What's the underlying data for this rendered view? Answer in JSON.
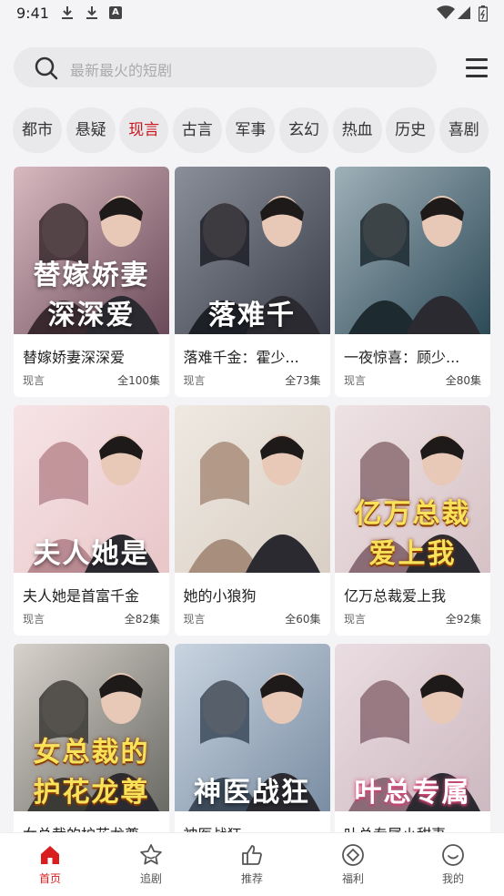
{
  "status": {
    "time": "9:41"
  },
  "search": {
    "placeholder": "最新最火的短剧"
  },
  "categories": [
    "都市",
    "悬疑",
    "现言",
    "古言",
    "军事",
    "玄幻",
    "热血",
    "历史",
    "喜剧"
  ],
  "active_category": "现言",
  "cards": [
    {
      "poster_text": "替嫁娇妻 深深爱",
      "title": "替嫁娇妻深深爱",
      "genre": "现言",
      "episodes": "全100集"
    },
    {
      "poster_text": "落难千",
      "title": "落难千金：霍少...",
      "genre": "现言",
      "episodes": "全73集"
    },
    {
      "poster_text": "",
      "title": "一夜惊喜：顾少...",
      "genre": "现言",
      "episodes": "全80集"
    },
    {
      "poster_text": "夫人她是",
      "title": "夫人她是首富千金",
      "genre": "现言",
      "episodes": "全82集"
    },
    {
      "poster_text": "",
      "title": "她的小狼狗",
      "genre": "现言",
      "episodes": "全60集"
    },
    {
      "poster_text": "亿万总裁 爱上我",
      "title": "亿万总裁爱上我",
      "genre": "现言",
      "episodes": "全92集"
    },
    {
      "poster_text": "女总裁的 护花龙尊",
      "title": "女总裁的护花龙尊",
      "genre": "",
      "episodes": ""
    },
    {
      "poster_text": "神医战狂",
      "title": "神医战狂",
      "genre": "",
      "episodes": ""
    },
    {
      "poster_text": "叶总专属",
      "title": "叶总专属小甜妻",
      "genre": "",
      "episodes": ""
    }
  ],
  "nav": [
    {
      "label": "首页",
      "icon": "home-icon",
      "active": true
    },
    {
      "label": "追剧",
      "icon": "star-icon",
      "active": false
    },
    {
      "label": "推荐",
      "icon": "thumbs-up-icon",
      "active": false
    },
    {
      "label": "福利",
      "icon": "gift-diamond-icon",
      "active": false
    },
    {
      "label": "我的",
      "icon": "smile-icon",
      "active": false
    }
  ],
  "colors": {
    "accent": "#c8161d",
    "nav_active": "#d81e1e"
  }
}
